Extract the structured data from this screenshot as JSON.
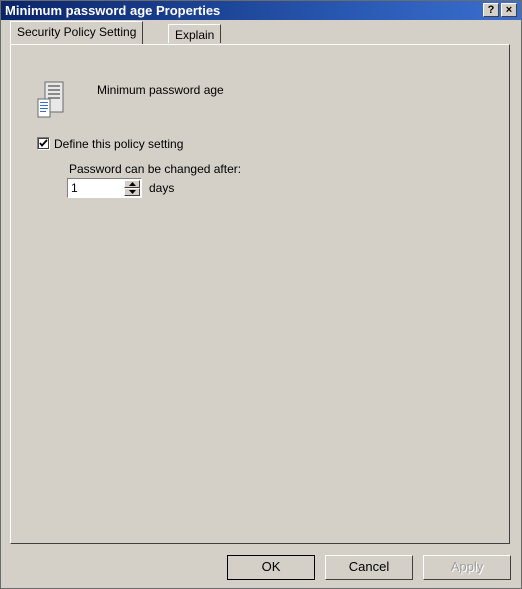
{
  "window": {
    "title": "Minimum password age Properties",
    "help_label": "?",
    "close_label": "×"
  },
  "tabs": [
    {
      "label": "Security Policy Setting",
      "selected": true
    },
    {
      "label": "Explain",
      "selected": false
    }
  ],
  "policy": {
    "name": "Minimum password age",
    "icon": "server-policy-icon"
  },
  "define_setting": {
    "label": "Define this policy setting",
    "checked": true
  },
  "password_change": {
    "label": "Password can be changed after:",
    "value": "1",
    "unit": "days"
  },
  "buttons": {
    "ok": "OK",
    "cancel": "Cancel",
    "apply": "Apply"
  },
  "colors": {
    "dialog_face": "#d4d0c8",
    "titlebar": "#0a246a"
  }
}
